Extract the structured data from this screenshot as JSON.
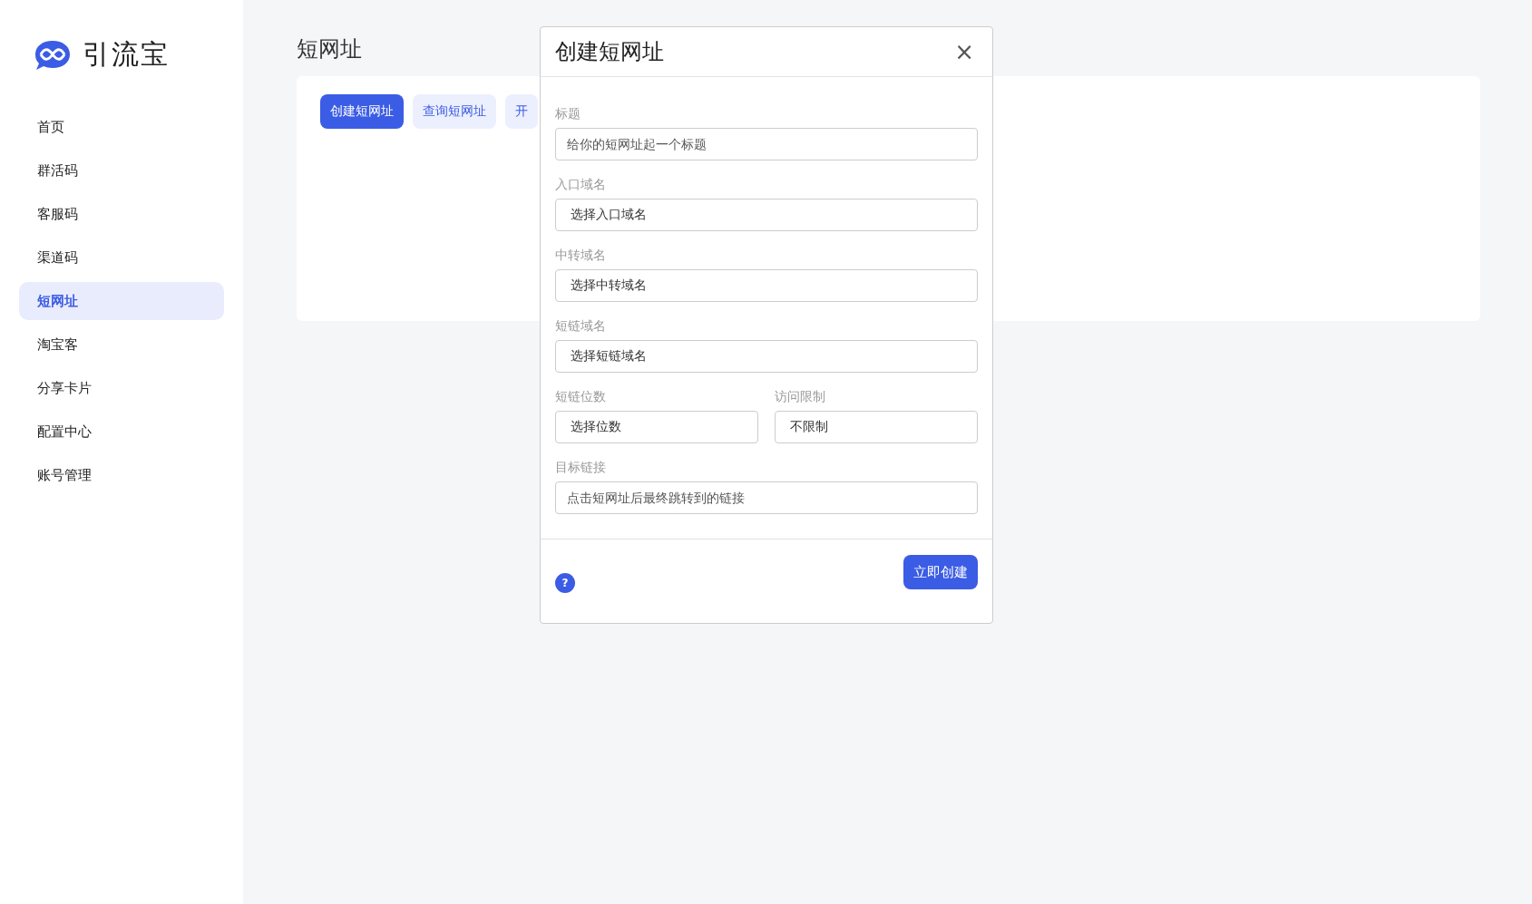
{
  "sidebar": {
    "brand": "引流宝",
    "items": [
      {
        "label": "首页",
        "selected": false
      },
      {
        "label": "群活码",
        "selected": false
      },
      {
        "label": "客服码",
        "selected": false
      },
      {
        "label": "渠道码",
        "selected": false
      },
      {
        "label": "短网址",
        "selected": true
      },
      {
        "label": "淘宝客",
        "selected": false
      },
      {
        "label": "分享卡片",
        "selected": false
      },
      {
        "label": "配置中心",
        "selected": false
      },
      {
        "label": "账号管理",
        "selected": false
      }
    ]
  },
  "page": {
    "title": "短网址",
    "actions": [
      {
        "label": "创建短网址",
        "selected": true
      },
      {
        "label": "查询短网址",
        "selected": false
      },
      {
        "label": "开",
        "selected": false
      }
    ]
  },
  "dialog": {
    "title": "创建短网址",
    "close": "×",
    "fields": [
      {
        "label": "标题",
        "kind": "input",
        "placeholder": "给你的短网址起一个标题"
      },
      {
        "label": "入口域名",
        "kind": "select",
        "value": "选择入口域名"
      },
      {
        "label": "中转域名",
        "kind": "select",
        "value": "选择中转域名"
      },
      {
        "label": "短链域名",
        "kind": "select",
        "value": "选择短链域名"
      },
      {
        "kind": "pair",
        "fields": [
          {
            "label": "短链位数",
            "kind": "select",
            "value": "选择位数"
          },
          {
            "label": "访问限制",
            "kind": "select",
            "value": "不限制"
          }
        ]
      },
      {
        "label": "目标链接",
        "kind": "input",
        "placeholder": "点击短网址后最终跳转到的链接"
      }
    ],
    "help": "?",
    "submit": "立即创建"
  }
}
